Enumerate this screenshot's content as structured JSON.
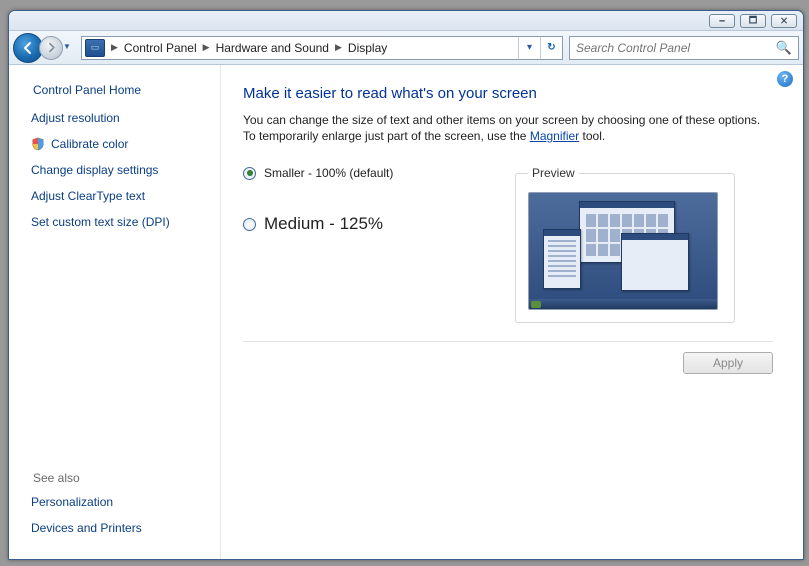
{
  "titlebar": {
    "min": "🗕",
    "max": "🗖",
    "close": "🗙"
  },
  "breadcrumb": {
    "root": "Control Panel",
    "mid": "Hardware and Sound",
    "leaf": "Display"
  },
  "search": {
    "placeholder": "Search Control Panel"
  },
  "sidebar": {
    "home": "Control Panel Home",
    "links": [
      "Adjust resolution",
      "Calibrate color",
      "Change display settings",
      "Adjust ClearType text",
      "Set custom text size (DPI)"
    ],
    "see_also_head": "See also",
    "see_also": [
      "Personalization",
      "Devices and Printers"
    ]
  },
  "main": {
    "title": "Make it easier to read what's on your screen",
    "desc_a": "You can change the size of text and other items on your screen by choosing one of these options. To temporarily enlarge just part of the screen, use the ",
    "desc_link": "Magnifier",
    "desc_b": " tool.",
    "opt_small": "Smaller - 100% (default)",
    "opt_medium": "Medium - 125%",
    "preview_legend": "Preview",
    "apply": "Apply"
  }
}
